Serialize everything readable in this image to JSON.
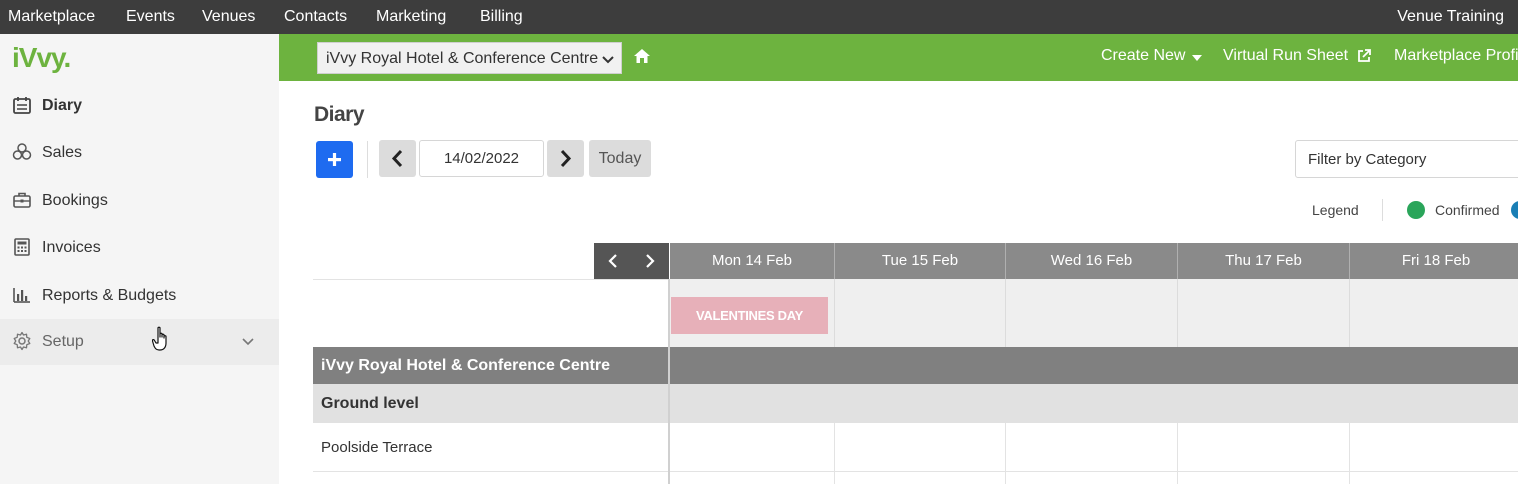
{
  "topnav": {
    "items": [
      "Marketplace",
      "Events",
      "Venues",
      "Contacts",
      "Marketing",
      "Billing"
    ],
    "account": "Venue Training"
  },
  "sidebar": {
    "logo": "iVvy.",
    "items": [
      {
        "label": "Diary",
        "icon": "calendar-icon"
      },
      {
        "label": "Sales",
        "icon": "sales-icon"
      },
      {
        "label": "Bookings",
        "icon": "briefcase-icon"
      },
      {
        "label": "Invoices",
        "icon": "calculator-icon"
      },
      {
        "label": "Reports & Budgets",
        "icon": "bar-chart-icon"
      },
      {
        "label": "Setup",
        "icon": "gear-icon"
      }
    ]
  },
  "header": {
    "venue": "iVvy Royal Hotel & Conference Centre",
    "create_new": "Create New",
    "virtual_run_sheet": "Virtual Run Sheet",
    "marketplace_profile": "Marketplace Profi"
  },
  "main": {
    "title": "Diary",
    "date": "14/02/2022",
    "today": "Today",
    "filter_placeholder": "Filter by Category",
    "legend": "Legend",
    "legend_items": [
      {
        "label": "Confirmed",
        "color": "#2aa55a"
      },
      {
        "label": "",
        "color": "#1a7fb5"
      }
    ]
  },
  "calendar": {
    "days": [
      "Mon 14 Feb",
      "Tue 15 Feb",
      "Wed 16 Feb",
      "Thu 17 Feb",
      "Fri 18 Feb"
    ],
    "event": "VALENTINES DAY",
    "venue_row": "iVvy Royal Hotel & Conference Centre",
    "level_row": "Ground level",
    "room_row": "Poolside Terrace"
  },
  "colors": {
    "topnav": "#3d3d3d",
    "brand_green": "#6db33f",
    "add_button": "#1e6bf0",
    "event_pink": "#e7b0b9"
  }
}
